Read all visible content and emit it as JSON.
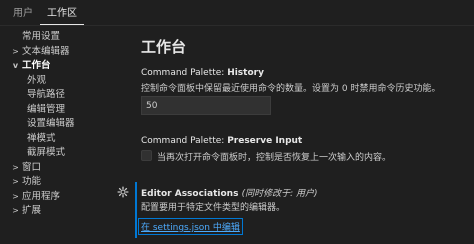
{
  "tabs": [
    {
      "label": "用户"
    },
    {
      "label": "工作区"
    }
  ],
  "tree": {
    "items": [
      {
        "label": "常用设置",
        "level": 0,
        "chevron": ""
      },
      {
        "label": "文本编辑器",
        "level": 0,
        "chevron": ">"
      },
      {
        "label": "工作台",
        "level": 0,
        "chevron": "v"
      },
      {
        "label": "外观",
        "level": 1
      },
      {
        "label": "导航路径",
        "level": 1
      },
      {
        "label": "编辑管理",
        "level": 1
      },
      {
        "label": "设置编辑器",
        "level": 1
      },
      {
        "label": "禅模式",
        "level": 1
      },
      {
        "label": "截屏模式",
        "level": 1
      },
      {
        "label": "窗口",
        "level": 0,
        "chevron": ">"
      },
      {
        "label": "功能",
        "level": 0,
        "chevron": ">"
      },
      {
        "label": "应用程序",
        "level": 0,
        "chevron": ">"
      },
      {
        "label": "扩展",
        "level": 0,
        "chevron": ">"
      }
    ]
  },
  "main": {
    "title": "工作台",
    "history": {
      "category": "Command Palette: ",
      "name": "History",
      "description": "控制命令面板中保留最近使用命令的数量。设置为 0 时禁用命令历史功能。",
      "value": "50"
    },
    "preserve": {
      "category": "Command Palette: ",
      "name": "Preserve Input",
      "description": "当再次打开命令面板时，控制是否恢复上一次输入的内容。",
      "checked": false
    },
    "editor_assoc": {
      "name": "Editor Associations",
      "modified": "(同时修改于: 用户)",
      "description": "配置要用于特定文件类型的编辑器。",
      "link": "在 settings.json 中编辑"
    }
  },
  "colors": {
    "background": "#1f1f1f",
    "accent": "#0078d4",
    "link": "#4daafc"
  }
}
